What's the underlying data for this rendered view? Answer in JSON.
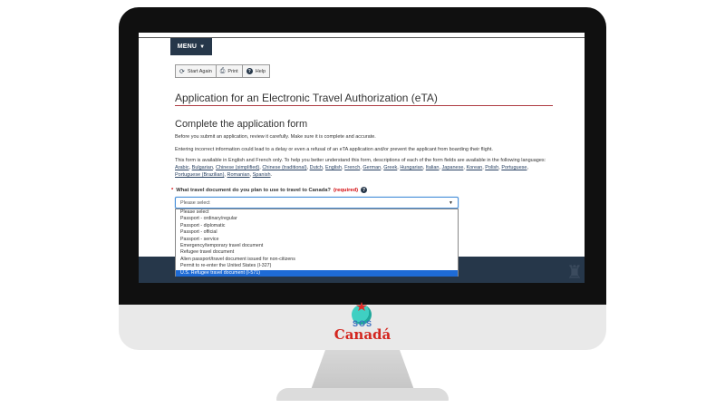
{
  "menu": {
    "label": "MENU"
  },
  "toolbar": {
    "start_again": "Start Again",
    "print": "Print",
    "help": "Help"
  },
  "page": {
    "title": "Application for an Electronic Travel Authorization (eTA)",
    "subtitle": "Complete the application form",
    "para1": "Before you submit an application, review it carefully. Make sure it is complete and accurate.",
    "para2": "Entering incorrect information could lead to a delay or even a refusal of an eTA application and/or prevent the applicant from boarding their flight.",
    "para3": "This form is available in English and French only. To help you better understand this form, descriptions of each of the form fields are available in the following languages:",
    "languages": [
      "Arabic",
      "Bulgarian",
      "Chinese (simplified)",
      "Chinese (traditional)",
      "Dutch",
      "English",
      "French",
      "German",
      "Greek",
      "Hungarian",
      "Italian",
      "Japanese",
      "Korean",
      "Polish",
      "Portuguese",
      "Portuguese (Brazilian)",
      "Romanian",
      "Spanish"
    ]
  },
  "question": {
    "star": "*",
    "text": "What travel document do you plan to use to travel to Canada?",
    "required": "(required)"
  },
  "select": {
    "value": "Please select",
    "options": [
      "Please select",
      "Passport - ordinary/regular",
      "Passport - diplomatic",
      "Passport - official",
      "Passport - service",
      "Emergency/temporary travel document",
      "Refugee travel document",
      "Alien passport/travel document issued for non-citizens",
      "Permit to re-enter the United States (I-327)",
      "U.S. Refugee travel document (I-571)"
    ],
    "highlighted_index": 9
  },
  "brand": {
    "sos": "SOS",
    "canada": "Canadá"
  },
  "colors": {
    "gc_blue": "#26374a",
    "accent_red": "#af3c43",
    "link": "#284162",
    "highlight": "#1e6bd6"
  }
}
